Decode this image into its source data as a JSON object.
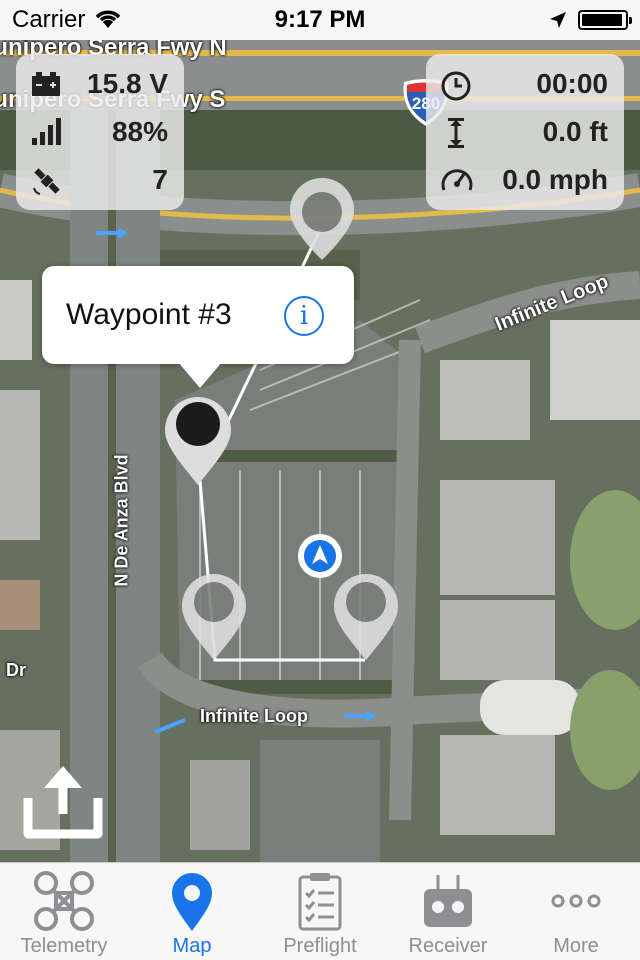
{
  "status_bar": {
    "carrier": "Carrier",
    "time": "9:17 PM",
    "battery_level": 0.95
  },
  "telemetry_left": {
    "battery_voltage": "15.8 V",
    "signal": "88%",
    "satellites": "7"
  },
  "telemetry_right": {
    "flight_time": "00:00",
    "altitude": "0.0 ft",
    "speed": "0.0 mph"
  },
  "map": {
    "labels": {
      "fwy_n": "Junipero Serra Fwy N",
      "fwy_s": "Junipero Serra Fwy S",
      "infinite_loop_top": "Infinite Loop",
      "infinite_loop_bottom": "Infinite Loop",
      "de_anza": "N De Anza Blvd",
      "dr": "Dr",
      "interstate": "280"
    }
  },
  "callout": {
    "title": "Waypoint #3"
  },
  "tabs": [
    {
      "label": "Telemetry",
      "icon": "quadcopter-icon",
      "active": false
    },
    {
      "label": "Map",
      "icon": "map-pin-icon",
      "active": true
    },
    {
      "label": "Preflight",
      "icon": "clipboard-checklist-icon",
      "active": false
    },
    {
      "label": "Receiver",
      "icon": "radio-controller-icon",
      "active": false
    },
    {
      "label": "More",
      "icon": "more-dots-icon",
      "active": false
    }
  ],
  "colors": {
    "accent": "#1a73e8",
    "inactive": "#8e8e93"
  }
}
